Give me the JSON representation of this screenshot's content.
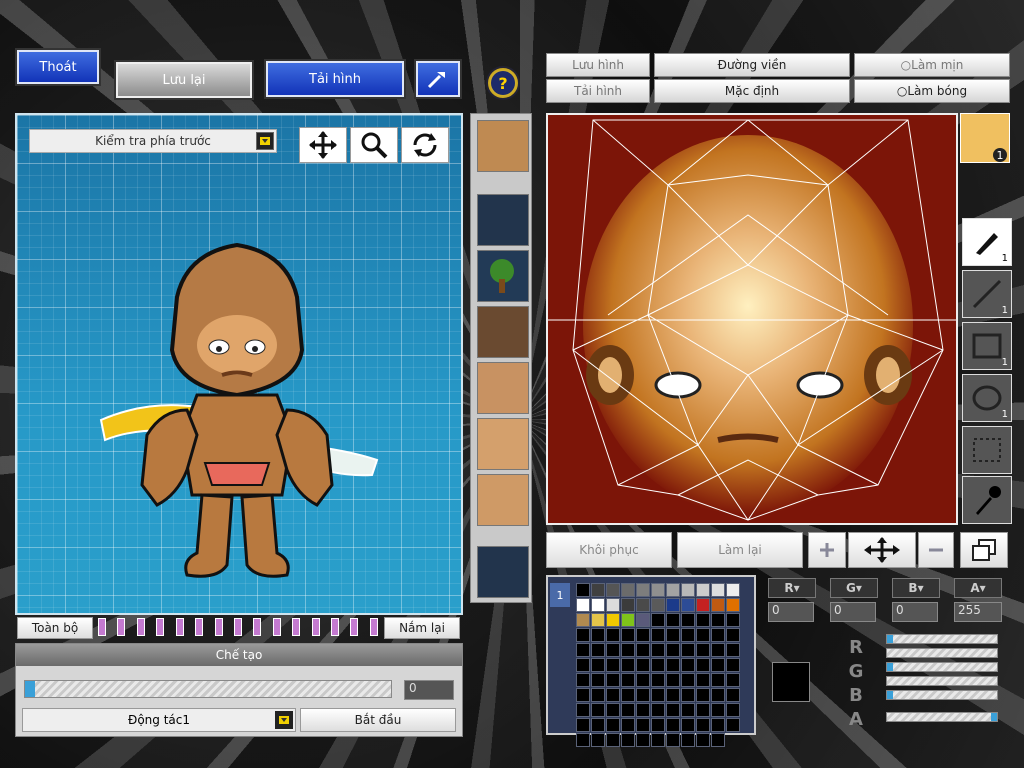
{
  "top_buttons": {
    "exit": "Thoát",
    "save": "Lưu lại",
    "reload": "Tải hình"
  },
  "right_tabs": {
    "save_image": "Lưu hình",
    "outline": "Đường viền",
    "smooth": "Làm mịn",
    "load_image": "Tải hình",
    "default": "Mặc định",
    "shade": "Làm bóng"
  },
  "viewport": {
    "view_select": "Kiểm tra phía trước"
  },
  "bottom_left": {
    "all_label": "Toàn bộ",
    "grab_label": "Nắm lại",
    "create_header": "Chế tạo",
    "progress_value": "0",
    "progress": 0.0,
    "action_select": "Động tác1",
    "start_label": "Bắt đầu"
  },
  "editor_buttons": {
    "restore": "Khôi phục",
    "redo": "Làm lại"
  },
  "color": {
    "r_label": "R",
    "g_label": "G",
    "b_label": "B",
    "a_label": "A",
    "r_value": "0",
    "g_value": "0",
    "b_value": "0",
    "a_value": "255",
    "current": "#000000"
  },
  "tools": {
    "pen_size": "1",
    "line_size": "1",
    "rect_size": "1",
    "ellipse_size": "1"
  },
  "avatar_badge": "1",
  "palette_tab": "1",
  "palette_colors": [
    "#000000",
    "#404040",
    "#555555",
    "#6b6b6b",
    "#7d7d7d",
    "#8f8f8f",
    "#a3a3a3",
    "#b8b8b8",
    "#cccccc",
    "#dddddd",
    "#eeeeee",
    "#ffffff",
    "#ffffff",
    "#dcdcdc",
    "#3b3b3b",
    "#4a4a4a",
    "#5a5a5a",
    "#1b3a8a",
    "#2d4c96",
    "#c42121",
    "#c05a12",
    "#e07000",
    "#b08a50",
    "#e3c44a",
    "#f0c800",
    "#7fc31a",
    "#5a5a7a"
  ]
}
